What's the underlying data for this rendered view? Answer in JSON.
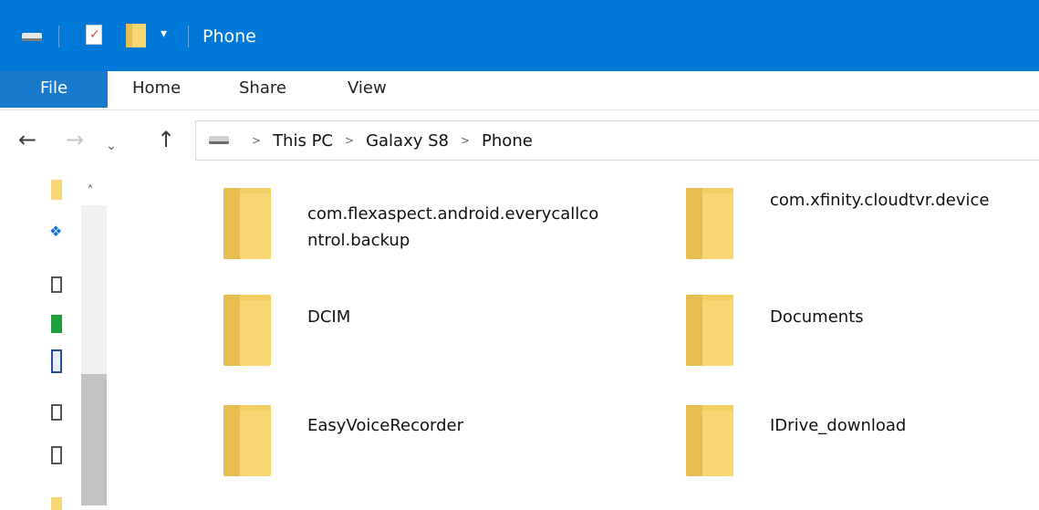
{
  "window": {
    "title": "Phone",
    "qat_dropdown_glyph": "▾"
  },
  "ribbon": {
    "tabs": [
      {
        "label": "File"
      },
      {
        "label": "Home"
      },
      {
        "label": "Share"
      },
      {
        "label": "View"
      }
    ]
  },
  "nav": {
    "back_glyph": "←",
    "forward_glyph": "→",
    "recent_glyph": "⌄",
    "up_glyph": "↑",
    "breadcrumbs": [
      "This PC",
      "Galaxy S8",
      "Phone"
    ],
    "separator_glyph": ">"
  },
  "navpane": {
    "scroll_up_glyph": "˄",
    "dropbox_glyph": "❖"
  },
  "folders": [
    {
      "name": "com.flexaspect.android.everycallcontrol.backup"
    },
    {
      "name": "com.xfinity.cloudtvr.device"
    },
    {
      "name": "DCIM"
    },
    {
      "name": "Documents"
    },
    {
      "name": "EasyVoiceRecorder"
    },
    {
      "name": "IDrive_download"
    }
  ],
  "colors": {
    "titlebar": "#0078d7",
    "file_tab": "#1979ca",
    "folder": "#f7d774"
  },
  "icons": [
    "drive-icon",
    "properties-icon",
    "new-folder-icon",
    "folder-icon",
    "dropbox-icon"
  ]
}
